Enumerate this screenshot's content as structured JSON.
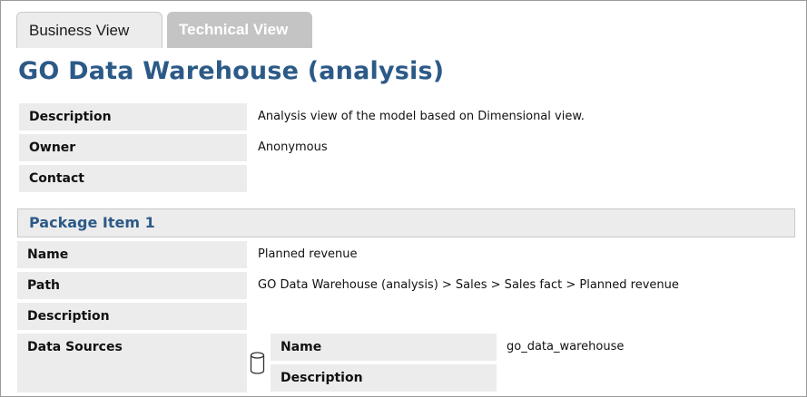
{
  "tabs": {
    "business": "Business View",
    "technical": "Technical View"
  },
  "page": {
    "title": "GO Data Warehouse (analysis)"
  },
  "model_properties": {
    "description_label": "Description",
    "description_value": "Analysis view of the model based on Dimensional view.",
    "owner_label": "Owner",
    "owner_value": "Anonymous",
    "contact_label": "Contact",
    "contact_value": ""
  },
  "package_item": {
    "header": "Package Item 1",
    "name_label": "Name",
    "name_value": "Planned revenue",
    "path_label": "Path",
    "path_value": "GO Data Warehouse (analysis) > Sales > Sales fact > Planned revenue",
    "description_label": "Description",
    "description_value": "",
    "data_sources_label": "Data Sources",
    "data_source": {
      "icon": "database-icon",
      "name_label": "Name",
      "name_value": "go_data_warehouse",
      "description_label": "Description",
      "description_value": ""
    }
  },
  "colors": {
    "title": "#2c5a87",
    "label_bg": "#ececec",
    "inactive_tab_bg": "#c4c4c4"
  }
}
